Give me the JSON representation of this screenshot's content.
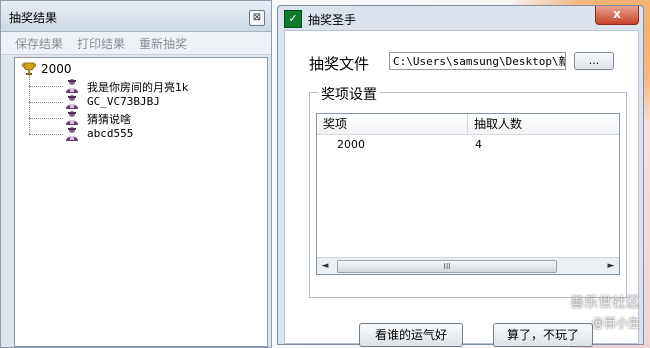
{
  "results_window": {
    "title": "抽奖结果",
    "close_label": "⊠",
    "menu": [
      "保存结果",
      "打印结果",
      "重新抽奖"
    ],
    "tree": {
      "root_label": "2000",
      "winners": [
        "我是你房间的月亮1k",
        "GC_VC73BJBJ",
        "猜猜说啥",
        "abcd555"
      ]
    }
  },
  "app_window": {
    "title": "抽奖圣手",
    "app_icon": "green-app-icon",
    "close_label": "x",
    "file_label": "抽奖文件",
    "file_path": "C:\\Users\\samsung\\Desktop\\新建",
    "browse_label": "...",
    "group_title": "奖项设置",
    "columns": [
      "奖项",
      "抽取人数"
    ],
    "rows": [
      {
        "prize": "2000",
        "count": "4"
      }
    ],
    "scroll_thumb": "III",
    "buttons": {
      "lucky": "看谁的运气好",
      "cancel": "算了，不玩了"
    }
  },
  "watermark": {
    "line1": "善乐世社区",
    "line2": "@百小生"
  }
}
